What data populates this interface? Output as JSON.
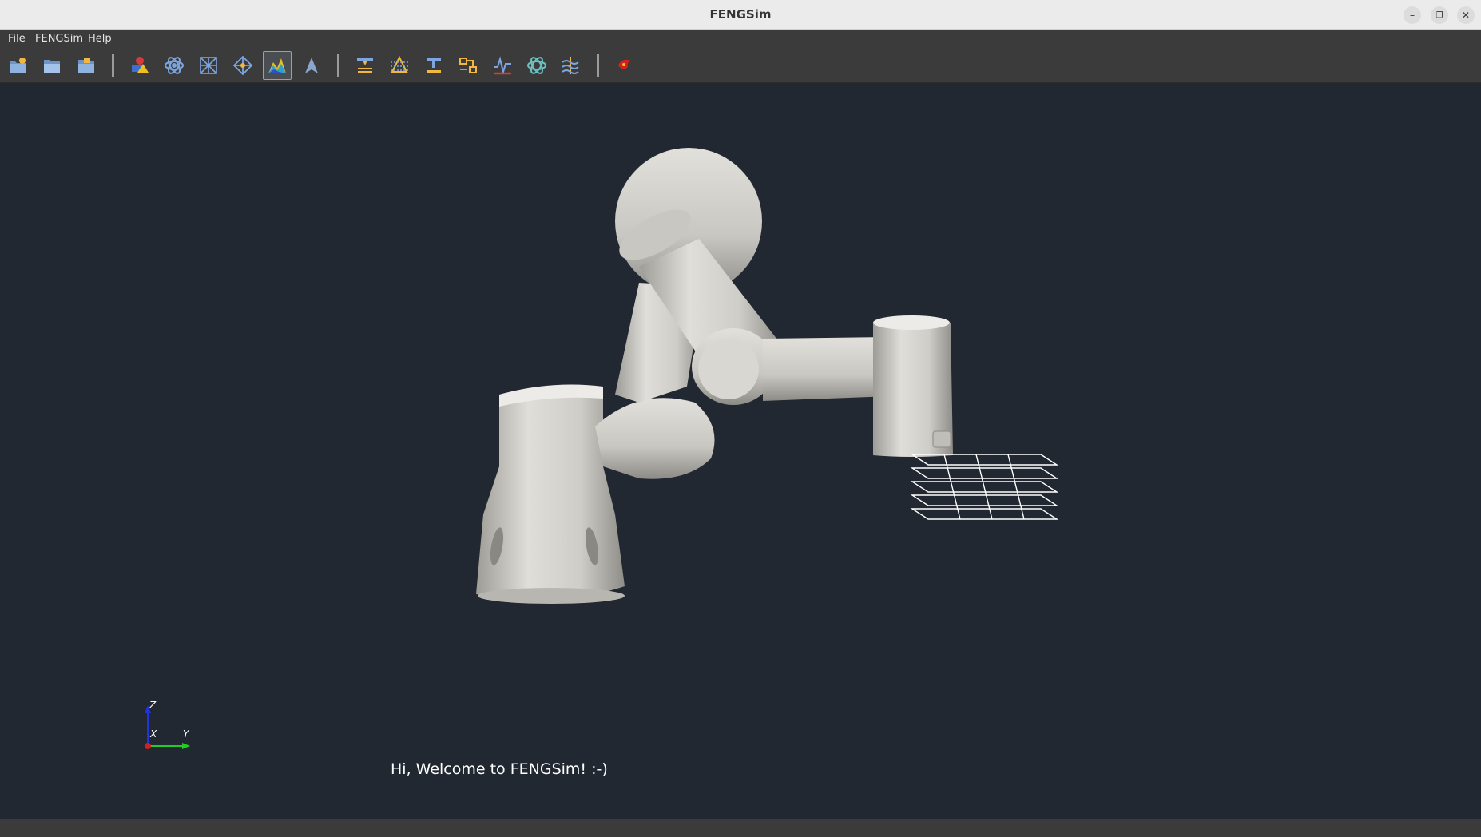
{
  "window": {
    "title": "FENGSim"
  },
  "menu": {
    "items": [
      "File",
      "FENGSim",
      "Help"
    ]
  },
  "toolbar": {
    "groups": [
      [
        "new-file-icon",
        "open-folder-icon",
        "open-project-icon"
      ],
      [
        "cad-shapes-icon",
        "physics-atom-icon",
        "mesh-icon",
        "geometry-node-icon",
        "visualization-plot-icon",
        "arrow-up-icon"
      ],
      [
        "additive-manufacturing-icon",
        "slicing-icon",
        "machining-icon",
        "process-flow-icon",
        "signal-analysis-icon",
        "molecular-icon",
        "fluid-icon"
      ],
      [
        "about-logo-icon"
      ]
    ],
    "active": "visualization-plot-icon"
  },
  "viewport": {
    "welcome_text": "Hi, Welcome to FENGSim! :-)",
    "axes": {
      "z_label": "Z",
      "x_label": "X",
      "y_label": "Y"
    }
  },
  "colors": {
    "titlebar": "#ebebeb",
    "menubar": "#3b3b3b",
    "viewport_bg": "#222831",
    "model": "#d6d4cf",
    "axis_x": "#cc2222",
    "axis_y": "#22cc22",
    "axis_z": "#2233dd"
  }
}
